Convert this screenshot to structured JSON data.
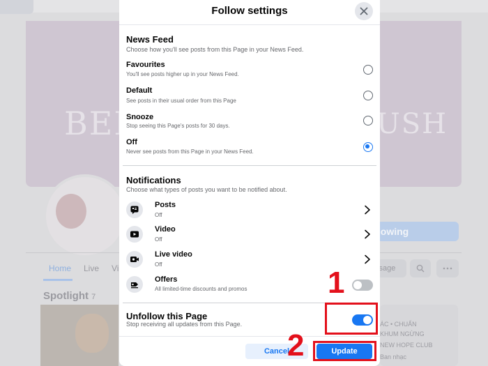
{
  "background_page": {
    "cover_text_left": "BEI",
    "cover_text_right": "USH",
    "following_label": "llowing",
    "tabs": [
      "Home",
      "Live",
      "Vi"
    ],
    "message_label": "ssage",
    "spotlight_label": "Spotlight",
    "spotlight_count": "7",
    "card_lines": [
      "ÁC • CHUẨN",
      "KHUM NGỪNG",
      "NEW HOPE CLUB",
      "Ban nhạc"
    ]
  },
  "dialog": {
    "title": "Follow settings",
    "news_feed": {
      "title": "News Feed",
      "subtitle": "Choose how you'll see posts from this Page in your News Feed.",
      "options": [
        {
          "label": "Favourites",
          "desc": "You'll see posts higher up in your News Feed.",
          "selected": false
        },
        {
          "label": "Default",
          "desc": "See posts in their usual order from this Page",
          "selected": false
        },
        {
          "label": "Snooze",
          "desc": "Stop seeing this Page's posts for 30 days.",
          "selected": false
        },
        {
          "label": "Off",
          "desc": "Never see posts from this Page in your News Feed.",
          "selected": true
        }
      ]
    },
    "notifications": {
      "title": "Notifications",
      "subtitle": "Choose what types of posts you want to be notified about.",
      "items": [
        {
          "icon": "post-icon",
          "label": "Posts",
          "state": "Off",
          "control": "chevron"
        },
        {
          "icon": "video-icon",
          "label": "Video",
          "state": "Off",
          "control": "chevron"
        },
        {
          "icon": "live-video-icon",
          "label": "Live video",
          "state": "Off",
          "control": "chevron"
        },
        {
          "icon": "offers-icon",
          "label": "Offers",
          "state": "All limited-time discounts and promos",
          "control": "toggle",
          "on": false
        }
      ]
    },
    "unfollow": {
      "label": "Unfollow this Page",
      "desc": "Stop receiving all updates from this Page.",
      "on": true
    },
    "buttons": {
      "cancel": "Cancel",
      "update": "Update"
    }
  },
  "annotations": {
    "step1": "1",
    "step2": "2"
  },
  "colors": {
    "accent": "#1877f2",
    "annotation": "#e3101b"
  }
}
